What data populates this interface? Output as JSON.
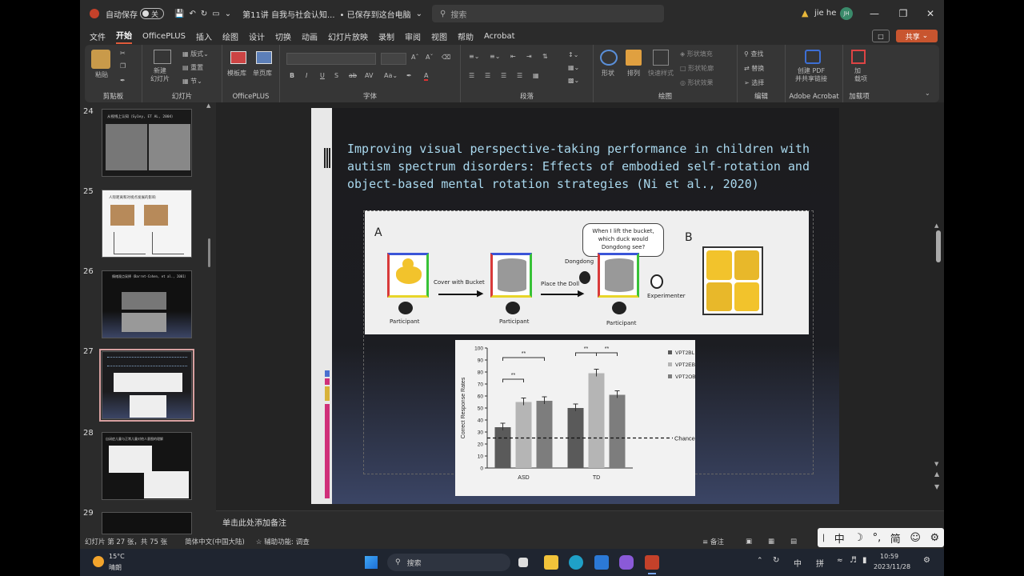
{
  "titlebar": {
    "autosave": "自动保存",
    "toggle": "关",
    "filename": "第11讲 自我与社会认知...",
    "saved": "• 已保存到这台电脑",
    "search": "搜索",
    "user": "jie he",
    "initials": "JH"
  },
  "menu": [
    "文件",
    "开始",
    "OfficePLUS",
    "插入",
    "绘图",
    "设计",
    "切换",
    "动画",
    "幻灯片放映",
    "录制",
    "审阅",
    "视图",
    "帮助",
    "Acrobat"
  ],
  "share": "共享",
  "ribbon": {
    "paste": "粘贴",
    "clipboard": "剪贴板",
    "new_slide": "新建\n幻灯片",
    "layout": "版式",
    "reset": "重置",
    "section": "节",
    "slides": "幻灯片",
    "template": "模板库",
    "single": "单页库",
    "officeplus": "OfficePLUS",
    "font": "字体",
    "paragraph": "段落",
    "shape": "形状",
    "arrange": "排列",
    "quickstyle": "快速样式",
    "fill": "形状填充",
    "outline": "形状轮廓",
    "effect": "形状效果",
    "drawing": "绘图",
    "find": "查找",
    "replace": "替换",
    "select": "选择",
    "editing": "编辑",
    "create_pdf": "创建 PDF\n并共享链接",
    "acrobat": "Adobe Acrobat",
    "addin": "加\n载项",
    "addins": "加载项"
  },
  "thumbs": [
    {
      "num": "24",
      "title": "从视线上认知（Sy1ey, ET AL, 2004）"
    },
    {
      "num": "25",
      "title": "人际距离和对视点发展的影响"
    },
    {
      "num": "26",
      "title": "情绪观点采择（Barret-Cohen, et al., 2001）"
    },
    {
      "num": "27",
      "title": ""
    },
    {
      "num": "28",
      "title": "自闭症儿童与正常儿童对他人意图的理解"
    },
    {
      "num": "29",
      "title": ""
    }
  ],
  "slide": {
    "title": "Improving visual perspective-taking performance in children with autism spectrum disorders: Effects of embodied self-rotation and object-based mental rotation strategies (Ni et al., 2020)",
    "figA": {
      "label_a": "A",
      "label_b": "B",
      "speech": "When I lift the bucket, which duck would Dongdong see?",
      "dongdong": "Dongdong",
      "cover": "Cover with Bucket",
      "place": "Place the Doll",
      "experimenter": "Experimenter",
      "participant": "Participant"
    }
  },
  "chart_data": {
    "type": "bar",
    "categories": [
      "ASD",
      "TD"
    ],
    "series": [
      {
        "name": "VPT2BL",
        "values": [
          34,
          50
        ]
      },
      {
        "name": "VPT2EB",
        "values": [
          55,
          79
        ]
      },
      {
        "name": "VPT2OB",
        "values": [
          56,
          61
        ]
      }
    ],
    "ylabel": "Correct Response Rates",
    "ylim": [
      0,
      100
    ],
    "yticks": [
      0,
      10,
      20,
      30,
      40,
      50,
      60,
      70,
      80,
      90,
      100
    ],
    "chance": 25,
    "chance_label": "Chance",
    "sig": "**",
    "colors": [
      "#5a5a5a",
      "#b5b5b5",
      "#7d7d7d"
    ]
  },
  "notes": "单击此处添加备注",
  "status": {
    "slide": "幻灯片 第 27 张，共 75 张",
    "lang": "简体中文(中国大陆)",
    "access": "辅助功能: 调查",
    "notes": "备注"
  },
  "taskbar": {
    "temp": "15°C",
    "weather": "晴朗",
    "search": "搜索",
    "time": "10:59",
    "date": "2023/11/28",
    "ime": "中",
    "lang2": "拼"
  },
  "ime_bar": [
    "中",
    "简"
  ]
}
